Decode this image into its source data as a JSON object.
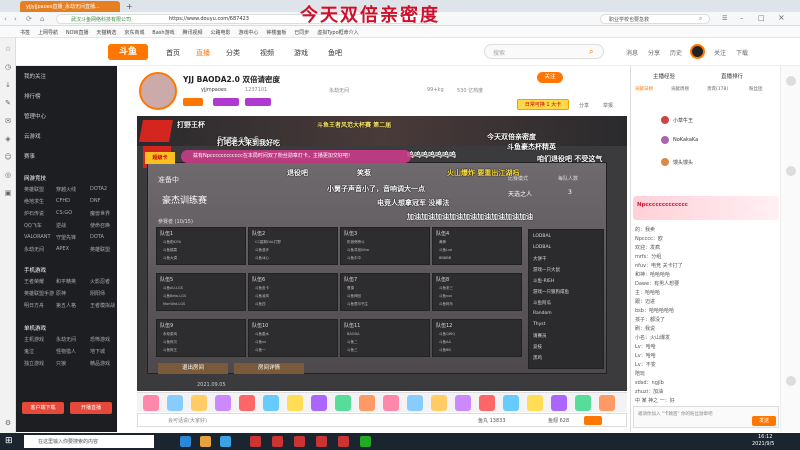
{
  "browser": {
    "tab_title": "yjjyjjpaoes直播_永劫无间直播...",
    "url_site": "武汉斗鱼网络科技有限公司",
    "url": "https://www.douyu.com/687423",
    "search_text": "职业学校也要急救",
    "bookmarks": [
      "书签",
      "上网导航",
      "NOW直播",
      "天猫精选",
      "京东商城",
      "Bash游戏",
      "腾讯视频",
      "公路电影",
      "游戏中心",
      "钟楼面板",
      "已同步",
      "虚拟Typo框命介入"
    ]
  },
  "overlay_title": "今天双倍亲密度",
  "douyu_nav": {
    "logo": "斗鱼",
    "items": [
      "首页",
      "直播",
      "分类",
      "视频",
      "游戏",
      "鱼吧"
    ],
    "search_placeholder": "搜索",
    "right_links": [
      "消息",
      "分享",
      "历史",
      "关注",
      "下载"
    ]
  },
  "left_panel": {
    "rows": [
      "我的关注",
      "排行榜",
      "管理中心",
      "云游戏",
      "赛事"
    ],
    "section_hot": "网游竞技",
    "hot_games": [
      "英雄联盟",
      "穿越火线",
      "DOTA2",
      "绝地求生",
      "CFHD",
      "DNF",
      "炉石传说",
      "CS:GO",
      "魔兽世界",
      "QQ飞车",
      "逆战",
      "使命召唤",
      "VALORANT",
      "守望先锋",
      "DOTA",
      "永劫无间",
      "APEX",
      "英雄联盟"
    ],
    "section_mobile": "手机游戏",
    "mobile_games": [
      "王者荣耀",
      "和平精英",
      "火影忍者",
      "英雄联盟手游",
      "原神",
      "阴阳师",
      "明日方舟",
      "第五人格",
      "王者模拟战"
    ],
    "section_single": "单机游戏",
    "single_games": [
      "主机游戏",
      "永劫无间",
      "恐怖游戏",
      "鬼泣",
      "怪物猎人",
      "地下城",
      "独立游戏",
      "只狼",
      "精品游戏"
    ],
    "buttons": [
      "客户端下载",
      "开播直播"
    ]
  },
  "room": {
    "title": "YJJ BAODA2.0 双倍请密度",
    "streamer": "yjjmpaoes",
    "id": "1237101",
    "category": "永劫无间",
    "follow_btn": "关注",
    "fans": "99+kg",
    "heat": "530 亿热度",
    "badge": "日常可换 1 大卡",
    "actions": [
      "分享",
      "举报"
    ]
  },
  "player": {
    "hud_left": "打野王杯",
    "hud_center": "斗鱼王者风范大杯赛 第二届",
    "hud_sub": "兵不厌诈 斗鱼一兵",
    "hud_right": "今天双倍亲密度",
    "panel_title": "准备中",
    "panel_name": "豪杰训练赛",
    "panel_left_label": "比赛模式",
    "panel_left_value": "天选之人",
    "panel_right_label": "每队人数",
    "panel_right_value": "3",
    "teams_header": "参赛者 (10/15)",
    "teams": [
      {
        "name": "队伍1",
        "lines": [
          "斗鱼阳KIYA",
          "斗鱼楼霖",
          "斗鱼大漠"
        ]
      },
      {
        "name": "队伍2",
        "lines": [
          "CC星期OAL打野",
          "斗鱼漫步",
          "斗鱼冰心"
        ]
      },
      {
        "name": "队伍3",
        "lines": [
          "机械旁跨斗",
          "斗鱼寻找Nina",
          "斗鱼中中"
        ]
      },
      {
        "name": "队伍4",
        "lines": [
          "黄蜂",
          "斗鱼Lue",
          "BBBBB"
        ]
      },
      {
        "name": "队伍5",
        "lines": [
          "斗鱼AU-LGS",
          "斗鱼Beta-LGS",
          "ManWat-LGS"
        ]
      },
      {
        "name": "队伍6",
        "lines": [
          "斗鱼皮卡",
          "斗鱼凌风",
          "斗鱼四"
        ]
      },
      {
        "name": "队伍7",
        "lines": [
          "曹操",
          "斗鱼神回",
          "斗鱼里印书生"
        ]
      },
      {
        "name": "队伍8",
        "lines": [
          "斗鱼老三",
          "斗鱼xxx",
          "斗鱼阿乐"
        ]
      },
      {
        "name": "队伍9",
        "lines": [
          "永劫菜鸡",
          "斗鱼阿贝",
          "斗鱼阿王"
        ]
      },
      {
        "name": "队伍10",
        "lines": [
          "斗鱼墨水",
          "斗鱼xx",
          "斗鱼一"
        ]
      },
      {
        "name": "队伍11",
        "lines": [
          "BAODA",
          "斗鱼二",
          "斗鱼三"
        ]
      },
      {
        "name": "队伍12",
        "lines": [
          "斗鱼QWQ",
          "斗鱼AA",
          "斗鱼BB"
        ]
      }
    ],
    "roster": [
      "LODBAL",
      "LODBAL",
      "大饼干",
      "游戏一只大鼠",
      "斗鱼-RIEH",
      "游戏一只狼狗咸鱼",
      "斗鱼阿瓜",
      "Random",
      "Thyst",
      "请赛员",
      "竞技",
      "黑鸡"
    ],
    "btn_exit": "退出房间",
    "btn_detail": "房间详情",
    "date": "2021.09.05",
    "danmu": [
      "打吧老大来到我好吃",
      "今天双倍亲密度",
      "呜呜呜呜呜呜呜",
      "斗鱼豪杰杯精英",
      "咱们退役吧 不受这气",
      "退役吧",
      "笑惹",
      "火山爆炸 要重出江湖吗",
      "小舅子声音小了，音响调大一点",
      "电竞人想拿冠军 没棒法",
      "加油加油加油加油加油加油加油加油加油",
      "超级卡",
      "兹有Npcccccccccccc在本局时间双了粉丝勋章灯卡，主播更加交好吧！"
    ]
  },
  "gifts_count": 20,
  "sendbar": {
    "placeholder": "会可话说(大家好)",
    "count1": "鱼丸 13833",
    "count2": "鱼翅 628"
  },
  "right_panel": {
    "tabs": [
      "主播经验",
      "直播排行"
    ],
    "sub_tabs": [
      "贡献日榜",
      "贡献周榜",
      "贵宾(178)",
      "粉丝团"
    ],
    "rank_users": [
      "小草牛王",
      "NoKakaKa",
      "馒头馒头"
    ],
    "promo": "Npccccccccccccc",
    "chat": [
      "的：我卖",
      "Npcccc：欧",
      "欢迎：发疯",
      "mrfs：分组",
      "nfuv：电竞 关卡打了",
      "和神：哈哈哈哈",
      "Dawe：有男人想要",
      "主：哈哈哈",
      "跟：迈进",
      "bsb：哈哈哈哈哈",
      "孩子：都没了",
      "刷：我说",
      "小名：火山爆发",
      "Lv：哈哈",
      "Lv：哈哈",
      "Lv：不变",
      "陪玩",
      "sdsd：ngjlb",
      "zhuzi：加油",
      "中 某 神之 一：好"
    ],
    "invite_text": "邀请你加入 \"卡赖茜\" 你的粉丝勋章吧",
    "send_label": "发送"
  },
  "taskbar": {
    "search": "在这里输入你要搜索的内容",
    "time": "16:12",
    "date": "2021/9/5"
  }
}
